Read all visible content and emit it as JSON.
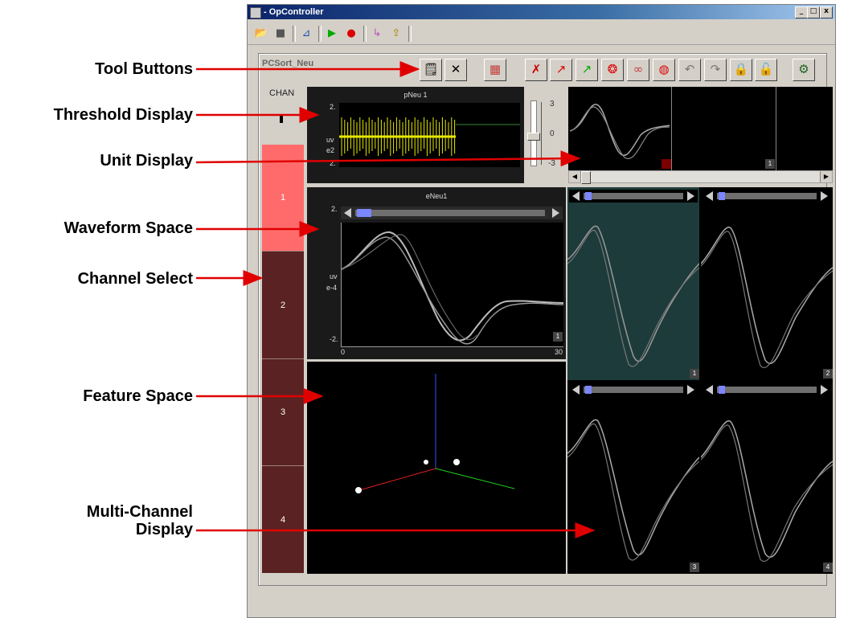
{
  "window": {
    "title": "- OpController",
    "min": "_",
    "max": "□",
    "close": "x"
  },
  "toolbar_icons": [
    "open-icon",
    "save-icon",
    "plot-icon",
    "play-icon",
    "record-icon",
    "link-icon",
    "export-icon"
  ],
  "panel": {
    "title": "PCSort_Neu"
  },
  "chan": {
    "header": "CHAN",
    "indicator": "1",
    "buttons": [
      "1",
      "2",
      "3",
      "4"
    ],
    "selected": "1"
  },
  "threshold": {
    "title": "pNeu 1",
    "y_top": "2.",
    "y_unit": "uv",
    "y_exp": "e2",
    "y_bottom": "2.",
    "slider_labels": [
      "3",
      "0",
      "-3"
    ]
  },
  "waveform": {
    "title": "eNeu1",
    "y_top": "2.",
    "y_unit": "uv",
    "y_exp": "e-4",
    "y_bottom": "-2.",
    "x_start": "0",
    "x_end": "30",
    "badge": "1"
  },
  "unit_display": {
    "badges": [
      "",
      "1"
    ]
  },
  "multi_channel": {
    "badges": [
      "1",
      "2",
      "3",
      "4"
    ]
  },
  "callouts": {
    "tool_buttons": "Tool Buttons",
    "threshold_display": "Threshold Display",
    "unit_display": "Unit Display",
    "waveform_space": "Waveform Space",
    "channel_select": "Channel Select",
    "feature_space": "Feature Space",
    "multi_channel_1": "Multi-Channel",
    "multi_channel_2": "Display"
  },
  "colors": {
    "chan_selected": "#ff6b6b",
    "chan_other": "#5a2222",
    "arrow": "#e00000",
    "threshold_trace": "#e8e800"
  }
}
